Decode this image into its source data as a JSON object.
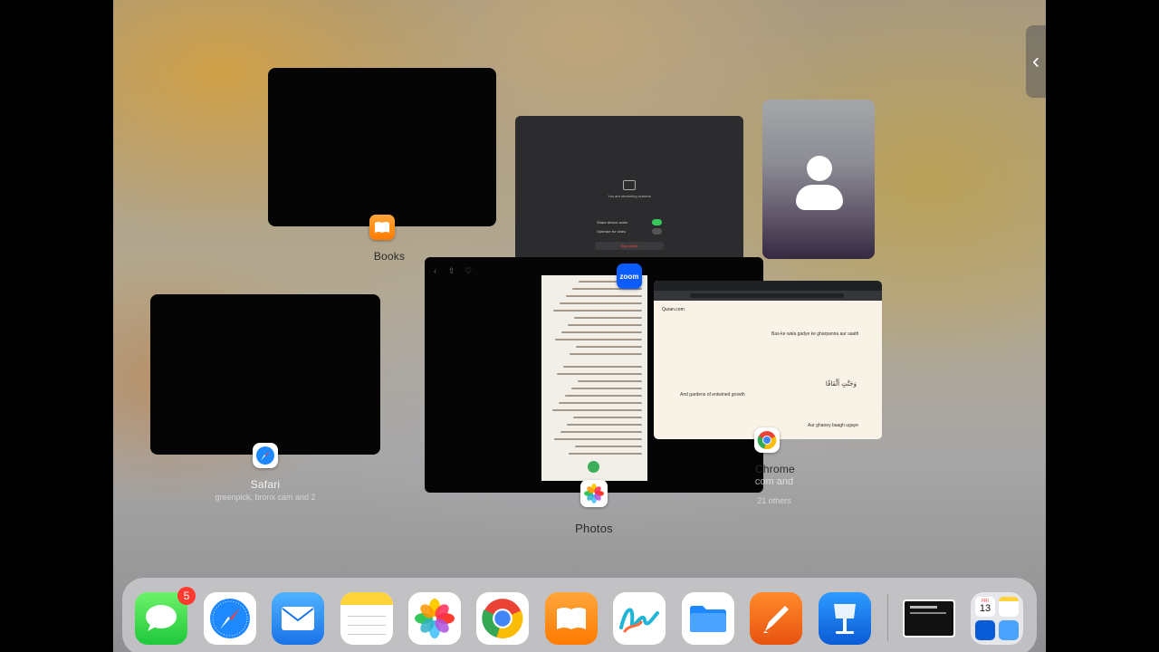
{
  "switcher": {
    "books": {
      "label": "Books"
    },
    "zoom": {
      "badge_label": "zoom",
      "sharing_text": "You are streaming screens",
      "share_audio_label": "Share device audio",
      "optimize_label": "Optimize for video",
      "stop_label": "Stop share"
    },
    "safari": {
      "label": "Safari",
      "subtitle": "greenpick, bronx cam and 2"
    },
    "photos": {
      "label": "Photos"
    },
    "chrome": {
      "label": "Chrome",
      "subtitle_1": "com and",
      "subtitle_2": "21 others",
      "site_title": "Quran.com",
      "verse_line_1": "Bas-ke wala gadye ke gharpanna aur saath",
      "verse_line_2": "And gardens of entwined growth",
      "arabic_text": "وَجَنَّٰتٍ أَلْفَافًا",
      "verse_line_3": "Aur ghaney baagh ugaye"
    }
  },
  "dock": {
    "messages_badge": "5",
    "calendar_day": "13",
    "calendar_weekday": "FRI"
  },
  "colors": {
    "dock_bg": "#d2d2d6",
    "badge_red": "#ff3b30",
    "chrome_page_bg": "#f8f3e6"
  }
}
